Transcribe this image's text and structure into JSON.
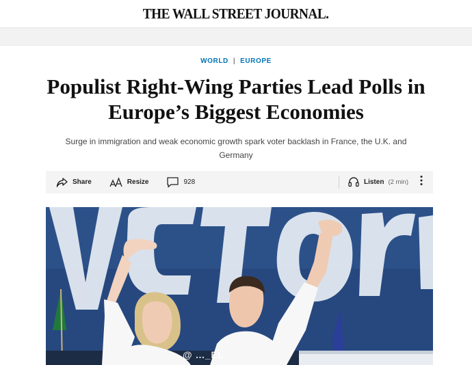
{
  "masthead": {
    "title": "THE WALL STREET JOURNAL."
  },
  "sections": {
    "primary": "WORLD",
    "separator": "|",
    "secondary": "EUROPE"
  },
  "article": {
    "headline": "Populist Right-Wing Parties Lead Polls in Europe’s Biggest Economies",
    "dek": "Surge in immigration and weak economic growth spark voter backlash in France, the U.K. and Germany"
  },
  "toolbar": {
    "share_label": "Share",
    "resize_label": "Resize",
    "comments_count": "928",
    "listen_label": "Listen",
    "listen_duration": "(2 min)"
  },
  "hero": {
    "watermark": "@ …_EL",
    "colors": {
      "banner_blue": "#27487f",
      "banner_letters": "#e8eef5",
      "shirt": "#f7f7f7"
    }
  },
  "icons": [
    "share-icon",
    "resize-icon",
    "comment-icon",
    "headphones-icon",
    "more-options-icon"
  ]
}
